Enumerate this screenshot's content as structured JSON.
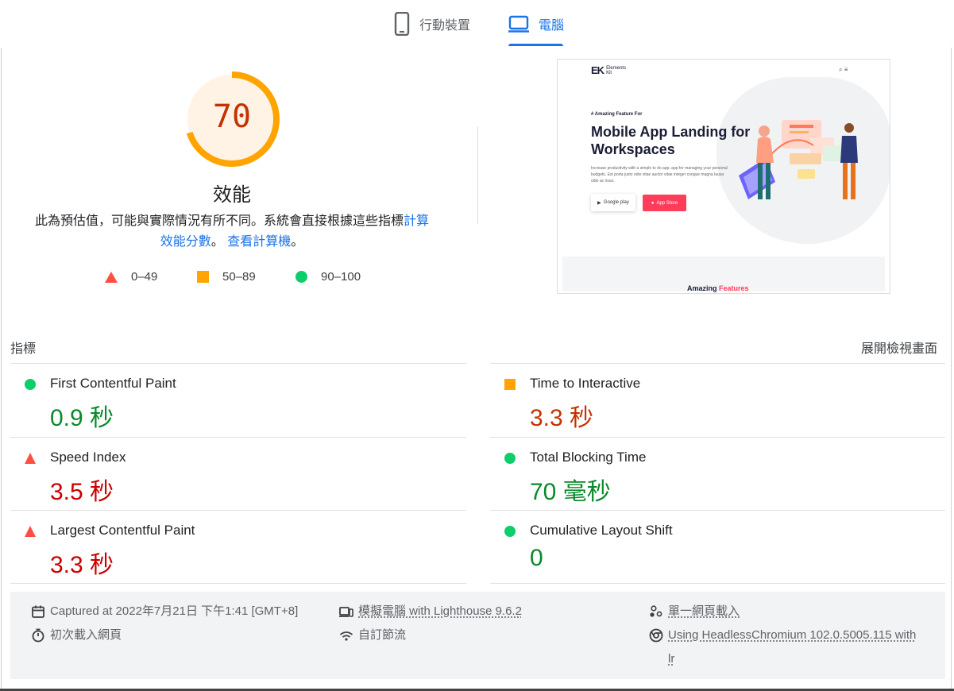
{
  "tabs": [
    {
      "label": "行動裝置",
      "icon": "phone-icon",
      "selected": false
    },
    {
      "label": "電腦",
      "icon": "laptop-icon",
      "selected": true
    }
  ],
  "gauge": {
    "score": "70",
    "score_fraction": 0.7,
    "title": "效能",
    "ring_color": "#ffa400",
    "fill_color": "#fff3e6",
    "text_color": "#c33300"
  },
  "description": {
    "text": "此為預估值，可能與實際情況有所不同。系統會直接根據這些指標",
    "link1": "計算效能分數",
    "separator": "。",
    "link2": "查看計算機",
    "end": "。"
  },
  "legend": [
    {
      "shape": "triangle",
      "color": "#ff4e42",
      "label": "0–49"
    },
    {
      "shape": "square",
      "color": "#ffa400",
      "label": "50–89"
    },
    {
      "shape": "circle",
      "color": "#0cce6b",
      "label": "90–100"
    }
  ],
  "screenshot": {
    "logo_mark": "EK",
    "logo_line1": "Elements",
    "logo_line2": "Kit",
    "kicker": "# Amazing Feature For",
    "headline": "Mobile App Landing for Workspaces",
    "lead": "Increase productivity with a simple to do app. app for managing your personal budgets. Est porta justo odio vitae auctor vitae integer congue magna lausa odio ac risus.",
    "google_play": "Google play",
    "app_store": "App Store",
    "amazing": "Amazing",
    "features": "Features"
  },
  "metrics_header": {
    "title": "指標",
    "expand": "展開檢視畫面"
  },
  "metrics": [
    {
      "name": "First Contentful Paint",
      "value": "0.9 秒",
      "rating": "pass"
    },
    {
      "name": "Time to Interactive",
      "value": "3.3 秒",
      "rating": "average"
    },
    {
      "name": "Speed Index",
      "value": "3.5 秒",
      "rating": "fail"
    },
    {
      "name": "Total Blocking Time",
      "value": "70 毫秒",
      "rating": "pass"
    },
    {
      "name": "Largest Contentful Paint",
      "value": "3.3 秒",
      "rating": "fail"
    },
    {
      "name": "Cumulative Layout Shift",
      "value": "0",
      "rating": "pass"
    }
  ],
  "footer": {
    "captured": "Captured at 2022年7月21日 下午1:41 [GMT+8]",
    "initial_load": "初次載入網頁",
    "emulated": "模擬電腦 with Lighthouse 9.6.2",
    "throttling": "自訂節流",
    "single_load": "單一網頁載入",
    "browser_line1": "Using HeadlessChromium 102.0.5005.115 with",
    "browser_line2": "lr"
  },
  "colors": {
    "pass": "#0a8a2a",
    "average": "#c33300",
    "fail": "#cc0000",
    "accent": "#1a73e8"
  }
}
